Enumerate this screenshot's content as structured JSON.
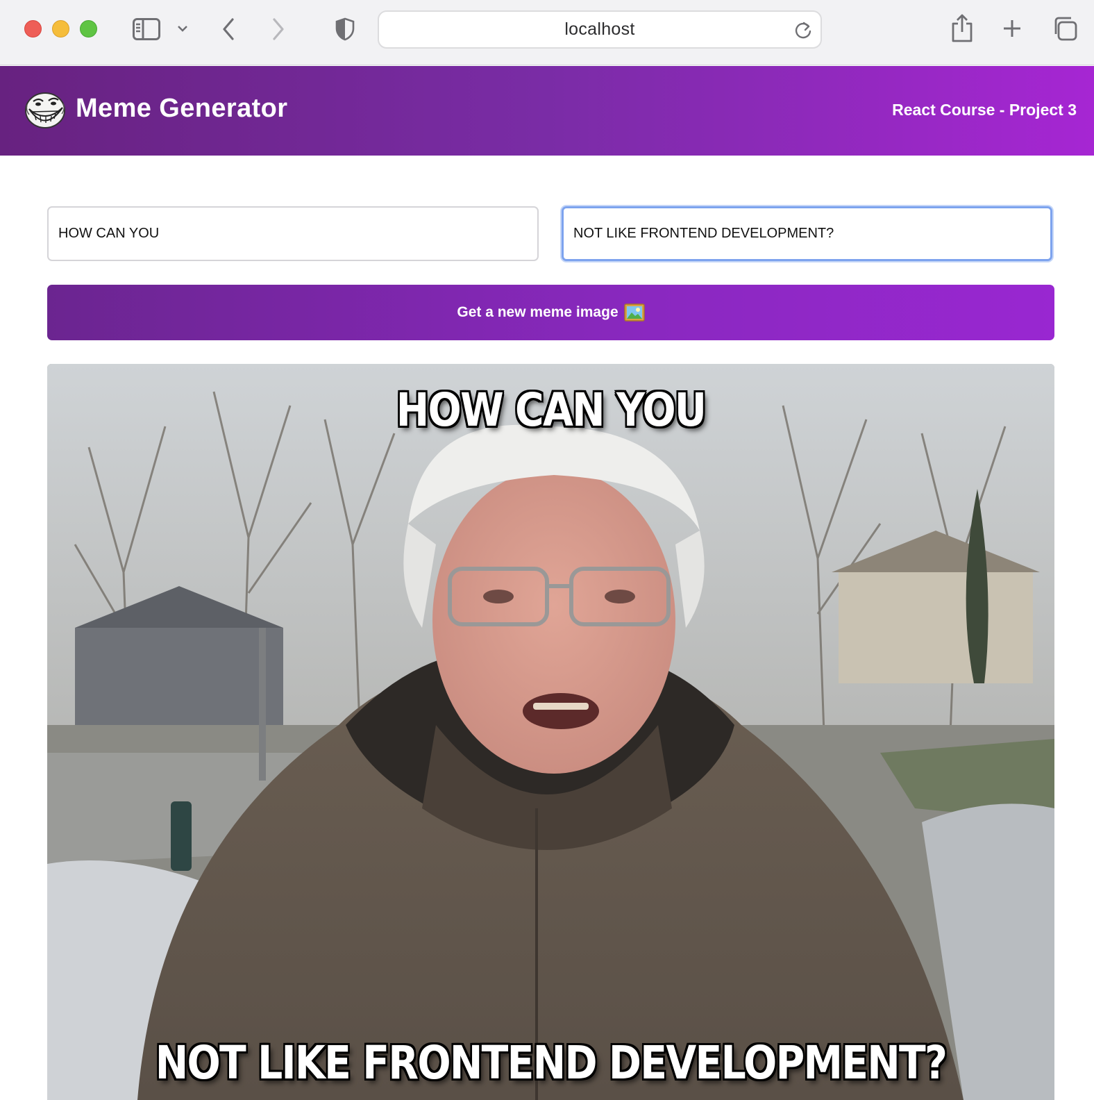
{
  "browser": {
    "url": "localhost"
  },
  "header": {
    "title": "Meme Generator",
    "subtitle": "React Course - Project 3",
    "logo_icon": "troll-face-icon"
  },
  "form": {
    "top_text": "HOW CAN YOU",
    "bottom_text": "NOT LIKE FRONTEND DEVELOPMENT?",
    "button_label": "Get a new meme image",
    "button_icon": "framed-picture-icon"
  },
  "meme": {
    "top_caption": "HOW CAN YOU",
    "bottom_caption": "NOT LIKE FRONTEND DEVELOPMENT?"
  },
  "colors": {
    "header_start": "#672280",
    "header_end": "#a626d3",
    "button_start": "#6b2590",
    "button_end": "#9927d1",
    "focus_ring": "#7da3ee"
  }
}
